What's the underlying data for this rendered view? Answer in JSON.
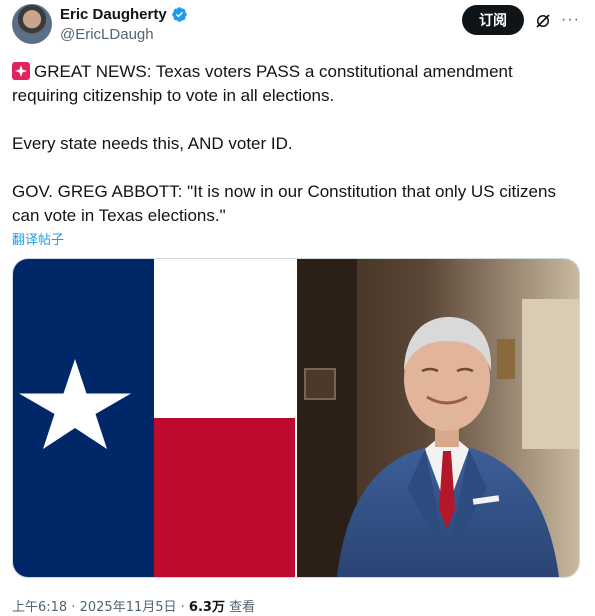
{
  "author": {
    "name": "Eric Daugherty",
    "handle": "@EricLDaugh",
    "verified": true
  },
  "actions": {
    "subscribe_label": "订阅",
    "more_label": "···"
  },
  "tweet": {
    "line1": "GREAT NEWS: Texas voters PASS a constitutional amendment requiring citizenship to vote in all elections.",
    "line2": "Every state needs this, AND voter ID.",
    "line3": "GOV. GREG ABBOTT: \"It is now in our Constitution that only US citizens can vote in Texas elections.\"",
    "translate_label": "翻译帖子"
  },
  "media": {
    "left": "texas-flag-image",
    "right": "governor-portrait-image"
  },
  "meta": {
    "time": "上午6:18",
    "separator": " · ",
    "date": "2025年11月5日",
    "views_count": "6.3万",
    "views_label": "查看"
  },
  "colors": {
    "flag_blue": "#002868",
    "flag_red": "#bf0a30",
    "verified_blue": "#1d9bf0",
    "link_blue": "#1d9bf0"
  },
  "icons": [
    "verified-badge-icon",
    "grok-icon",
    "more-icon",
    "siren-emoji-icon"
  ]
}
